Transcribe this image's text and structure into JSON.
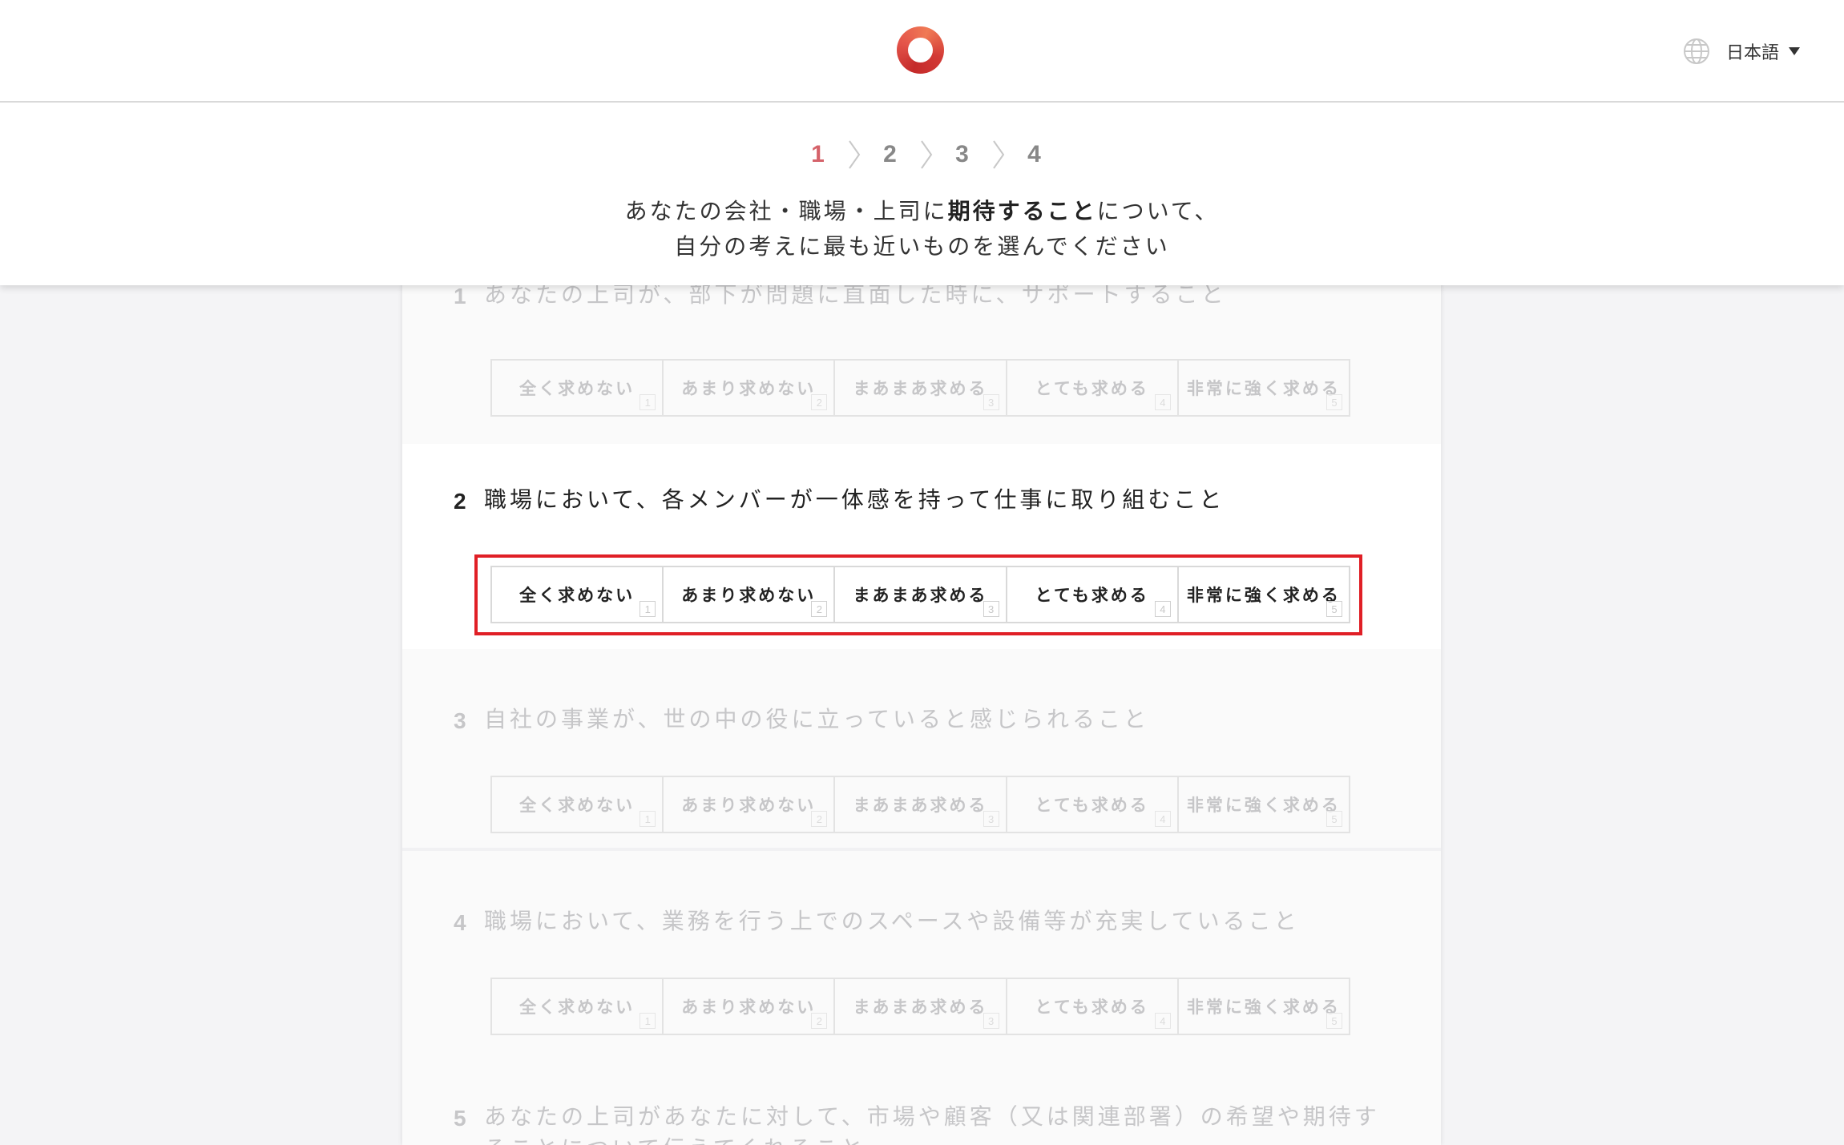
{
  "header": {
    "language": "日本語",
    "steps": [
      "1",
      "2",
      "3",
      "4"
    ],
    "active_step": "1",
    "instruction_line1_before": "あなたの会社・職場・上司に",
    "instruction_line1_bold": "期待すること",
    "instruction_line1_after": "について、",
    "instruction_line2": "自分の考えに最も近いものを選んでください"
  },
  "options": [
    {
      "label": "全く求めない",
      "key": "1"
    },
    {
      "label": "あまり求めない",
      "key": "2"
    },
    {
      "label": "まあまあ求める",
      "key": "3"
    },
    {
      "label": "とても求める",
      "key": "4"
    },
    {
      "label": "非常に強く求める",
      "key": "5"
    }
  ],
  "questions": [
    {
      "number": "1",
      "text": "あなたの上司が、部下が問題に直面した時に、サポートすること"
    },
    {
      "number": "2",
      "text": "職場において、各メンバーが一体感を持って仕事に取り組むこと"
    },
    {
      "number": "3",
      "text": "自社の事業が、世の中の役に立っていると感じられること"
    },
    {
      "number": "4",
      "text": "職場において、業務を行う上でのスペースや設備等が充実していること"
    },
    {
      "number": "5",
      "text": "あなたの上司があなたに対して、市場や顧客（又は関連部署）の希望や期待することについて伝えてくれること"
    }
  ],
  "colors": {
    "accent": "#d5626a",
    "highlight": "#e01f26",
    "logo": "#d33a36"
  }
}
